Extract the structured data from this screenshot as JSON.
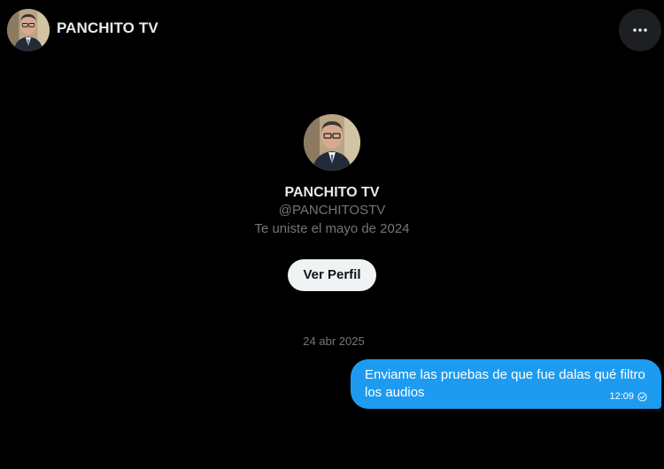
{
  "header": {
    "title": "PANCHITO TV",
    "more_icon": "more-horizontal-icon"
  },
  "profile": {
    "name": "PANCHITO TV",
    "handle": "@PANCHITOSTV",
    "joined": "Te uniste el mayo de 2024",
    "view_profile_label": "Ver Perfil"
  },
  "conversation": {
    "date": "24 abr 2025",
    "messages": [
      {
        "text": "Enviame las pruebas de que fue dalas qué filtro los audios",
        "time": "12:09",
        "status_icon": "sent-check-icon",
        "direction": "outgoing"
      }
    ]
  },
  "colors": {
    "background": "#000000",
    "bubble": "#1d9bf0",
    "muted_text": "#71767b",
    "primary_text": "#e7e9ea",
    "button_bg": "#eff3f4"
  }
}
